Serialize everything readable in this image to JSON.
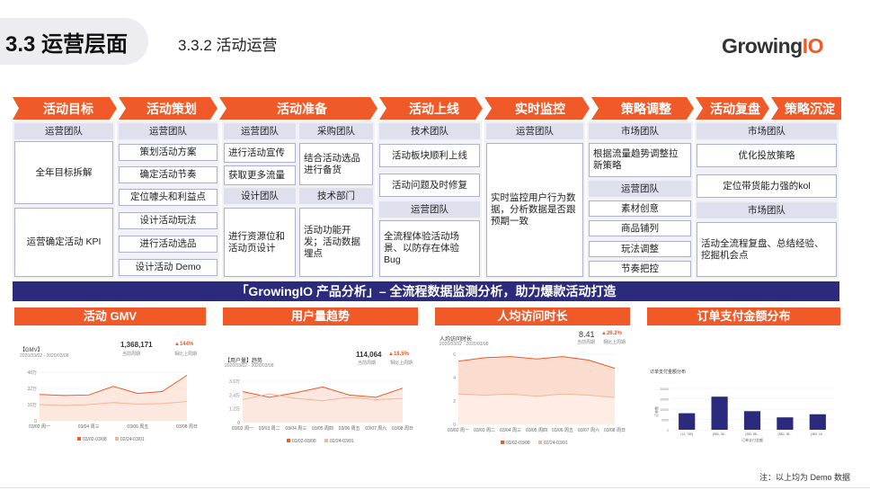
{
  "header": {
    "title": "3.3 运营层面",
    "subtitle": "3.3.2 活动运营",
    "logo_main": "Growing",
    "logo_accent": "IO"
  },
  "stages": [
    "活动目标",
    "活动策划",
    "活动准备",
    "活动上线",
    "实时监控",
    "策略调整",
    "活动复盘",
    "策略沉淀"
  ],
  "columns": {
    "goal": {
      "team": "运营团队",
      "item1": "全年目标拆解",
      "item2": "运营确定活动 KPI"
    },
    "plan": {
      "team": "运营团队",
      "items": [
        "策划活动方案",
        "确定活动节奏",
        "定位噱头和利益点",
        "设计活动玩法",
        "进行活动选品",
        "设计活动 Demo"
      ]
    },
    "prep": {
      "ops_team": "运营团队",
      "ops_items": [
        "进行活动宣传",
        "获取更多流量"
      ],
      "design_team": "设计团队",
      "design_item": "进行资源位和活动页设计",
      "purchase_team": "采购团队",
      "purchase_item": "结合活动选品进行备货",
      "tech_team": "技术部门",
      "tech_item": "活动功能开发；活动数据埋点"
    },
    "launch": {
      "tech_team": "技术团队",
      "tech_items": [
        "活动板块顺利上线",
        "活动问题及时修复"
      ],
      "ops_team": "运营团队",
      "ops_item": "全流程体验活动场景、以防存在体验 Bug"
    },
    "monitor": {
      "team": "运营团队",
      "item": "实时监控用户行为数据，分析数据是否跟预期一致"
    },
    "adjust": {
      "market_team": "市场团队",
      "market_item": "根据流量趋势调整拉新策略",
      "ops_team": "运营团队",
      "ops_items": [
        "素材创意",
        "商品铺列",
        "玩法调整",
        "节奏把控"
      ]
    },
    "review": {
      "team1": "市场团队",
      "items1": [
        "优化投放策略",
        "定位带货能力强的kol"
      ],
      "team2": "市场团队",
      "item2": "活动全流程复盘、总结经验、挖掘机会点"
    }
  },
  "banner": "「GrowingIO 产品分析」– 全流程数据监测分析，助力爆款活动打造",
  "charts_titles": [
    "活动 GMV",
    "用户量趋势",
    "人均访问时长",
    "订单支付金额分布"
  ],
  "chart1": {
    "label": "【GMV】",
    "date_range": "2020/03/02 - 2020/03/08",
    "big_value": "1,368,171",
    "big_caption": "当前周期",
    "delta": "▲144%",
    "delta_caption": "相比上周期",
    "y_ticks": [
      "48万",
      "32万",
      "16万",
      "0"
    ],
    "x_ticks": [
      "03/02 周一",
      "03/04 周三",
      "03/06 周五",
      "03/08 周日"
    ],
    "legend": [
      "03/02-03/08",
      "02/24-03/01"
    ]
  },
  "chart2": {
    "label": "【用户量】趋势",
    "date_range": "2020/03/02 - 2020/03/08",
    "big_value": "114,064",
    "big_caption": "当前周期",
    "delta": "▲18.5%",
    "delta_caption": "相比上周期",
    "y_ticks": [
      "3.6万",
      "2.4万",
      "1.2万",
      "0"
    ],
    "x_ticks": [
      "03/02 周一",
      "03/03 周二",
      "03/04 周三",
      "03/05 周四",
      "03/06 周五",
      "03/07 周六",
      "03/08 周日"
    ],
    "legend": [
      "03/02-03/08",
      "02/24-03/01"
    ]
  },
  "chart3": {
    "label": "人均访问时长",
    "date_range": "2020/03/02 - 2020/03/08",
    "big_value": "8.41",
    "big_caption": "当前周期",
    "delta": "▲26.2%",
    "delta_caption": "相比上周期",
    "y_ticks": [
      "6",
      "4",
      "2",
      "0"
    ],
    "x_ticks": [
      "03/02 周一",
      "03/03 周二",
      "03/04 周三",
      "03/05 周四",
      "03/06 周五",
      "03/07 周六",
      "03/08 周日"
    ],
    "legend": [
      "03/02-03/08",
      "02/24-03/01"
    ]
  },
  "chart4": {
    "label": "订单支付金额分布",
    "y_label": "订单数",
    "y_ticks": [
      "20000",
      "15000",
      "10000",
      "5000",
      "0"
    ],
    "x_ticks": [
      "(12, 780]",
      "(980, 38...",
      "(380, 88...",
      "(880, 38...",
      "(380, 18..."
    ],
    "x_title": "订单支付金额"
  },
  "footnote": "注：以上均为 Demo 数据",
  "chart_data": [
    {
      "type": "line",
      "title": "活动 GMV",
      "x": [
        "03/02",
        "03/03",
        "03/04",
        "03/05",
        "03/06",
        "03/07",
        "03/08"
      ],
      "series": [
        {
          "name": "03/02-03/08",
          "values": [
            260000,
            250000,
            255000,
            340000,
            270000,
            290000,
            450000
          ]
        },
        {
          "name": "02/24-03/01",
          "values": [
            160000,
            150000,
            160000,
            180000,
            165000,
            170000,
            190000
          ]
        }
      ],
      "ylim": [
        0,
        480000
      ]
    },
    {
      "type": "line",
      "title": "用户量趋势",
      "x": [
        "03/02",
        "03/03",
        "03/04",
        "03/05",
        "03/06",
        "03/07",
        "03/08"
      ],
      "series": [
        {
          "name": "03/02-03/08",
          "values": [
            27000,
            22000,
            26000,
            31000,
            24000,
            22000,
            30000
          ]
        },
        {
          "name": "02/24-03/01",
          "values": [
            20000,
            25000,
            21000,
            19000,
            22000,
            20000,
            21000
          ]
        }
      ],
      "ylim": [
        0,
        36000
      ]
    },
    {
      "type": "area",
      "title": "人均访问时长",
      "x": [
        "03/02",
        "03/03",
        "03/04",
        "03/05",
        "03/06",
        "03/07",
        "03/08"
      ],
      "series": [
        {
          "name": "03/02-03/08",
          "values": [
            5.4,
            5.7,
            5.8,
            5.6,
            5.8,
            5.5,
            4.8
          ]
        },
        {
          "name": "02/24-03/01",
          "values": [
            2.6,
            2.5,
            2.6,
            2.4,
            2.6,
            2.5,
            2.3
          ]
        }
      ],
      "ylim": [
        0,
        6
      ]
    },
    {
      "type": "bar",
      "title": "订单支付金额分布",
      "categories": [
        "(12, 780]",
        "(980, 38...",
        "(380, 88...",
        "(880, 38...",
        "(380, 18..."
      ],
      "values": [
        8000,
        16000,
        9000,
        6000,
        7500
      ],
      "ylim": [
        0,
        20000
      ]
    }
  ],
  "colors": {
    "orange": "#f05a28",
    "navy": "#2c2a7c",
    "box_border": "#aeb0cf",
    "header_fill": "#dfe0ee",
    "bar": "#2c2a7c",
    "line_prev": "#f5b59a"
  }
}
